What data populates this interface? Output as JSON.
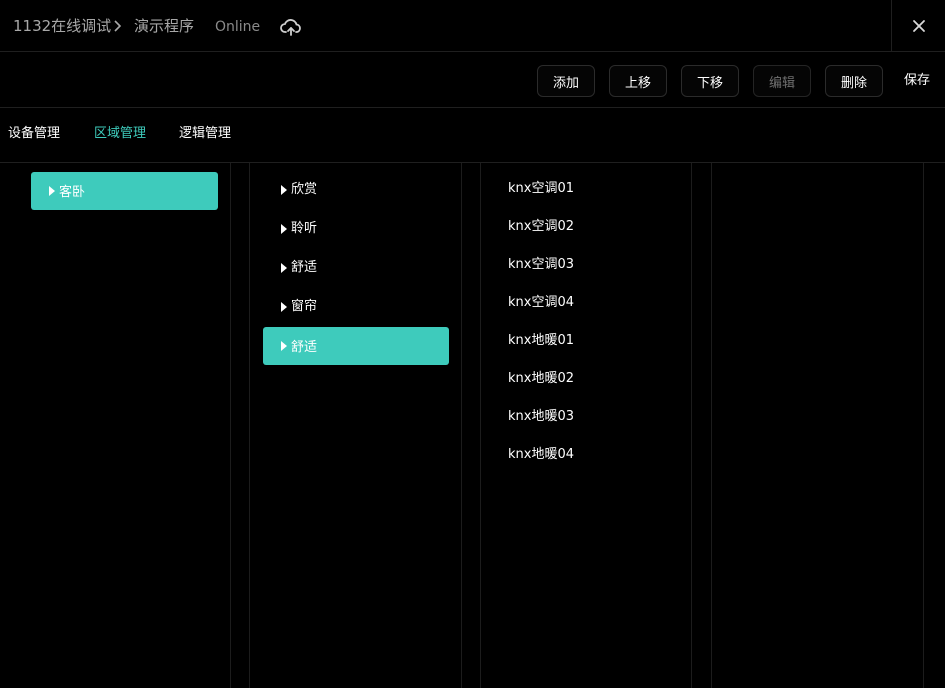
{
  "header": {
    "project": "1132在线调试",
    "program": "演示程序",
    "status": "Online"
  },
  "toolbar": {
    "add": "添加",
    "move_up": "上移",
    "move_down": "下移",
    "edit": "编辑",
    "delete": "删除",
    "save": "保存"
  },
  "tabs": [
    "设备管理",
    "区域管理",
    "逻辑管理"
  ],
  "areas": [
    "客卧"
  ],
  "sub_areas": [
    "欣赏",
    "聆听",
    "舒适",
    "窗帘",
    "舒适"
  ],
  "devices": [
    "knx空调01",
    "knx空调02",
    "knx空调03",
    "knx空调04",
    "knx地暖01",
    "knx地暖02",
    "knx地暖03",
    "knx地暖04"
  ],
  "colors": {
    "accent": "#3ecbbc",
    "background": "#000000",
    "divider": "#1f1f1f"
  },
  "icons": {
    "separator": "chevron-right-icon",
    "cloud": "cloud-sync-icon",
    "close": "close-icon",
    "expand": "caret-right-icon"
  }
}
